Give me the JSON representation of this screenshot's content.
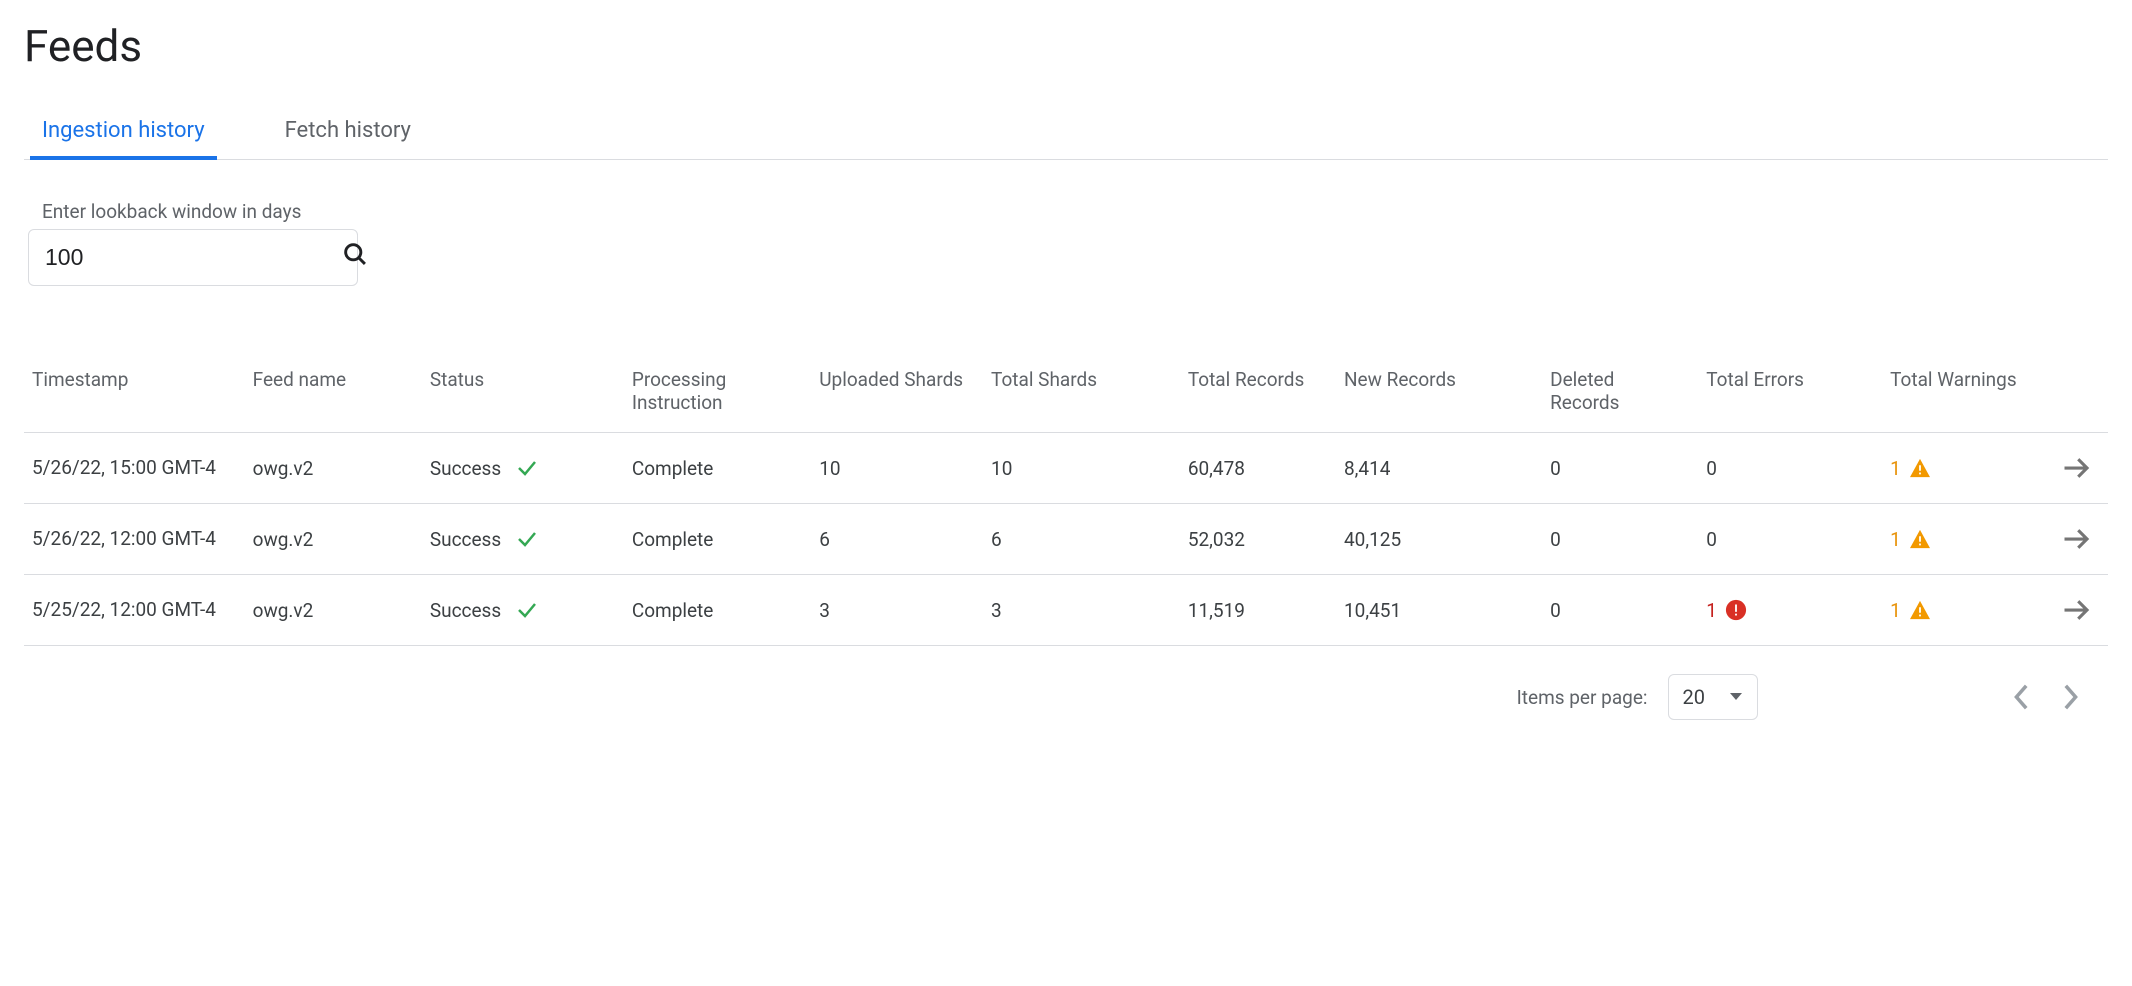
{
  "page_title": "Feeds",
  "tabs": [
    {
      "label": "Ingestion history",
      "active": true
    },
    {
      "label": "Fetch history",
      "active": false
    }
  ],
  "lookback": {
    "label": "Enter lookback window in days",
    "value": "100"
  },
  "columns": [
    "Timestamp",
    "Feed name",
    "Status",
    "Processing Instruction",
    "Uploaded Shards",
    "Total Shards",
    "Total Records",
    "New Records",
    "Deleted Records",
    "Total Errors",
    "Total Warnings"
  ],
  "rows": [
    {
      "timestamp": "5/26/22, 15:00 GMT-4",
      "feed_name": "owg.v2",
      "status": "Success",
      "processing_instruction": "Complete",
      "uploaded_shards": "10",
      "total_shards": "10",
      "total_records": "60,478",
      "new_records": "8,414",
      "deleted_records": "0",
      "total_errors": "0",
      "total_errors_has_icon": false,
      "total_warnings": "1"
    },
    {
      "timestamp": "5/26/22, 12:00 GMT-4",
      "feed_name": "owg.v2",
      "status": "Success",
      "processing_instruction": "Complete",
      "uploaded_shards": "6",
      "total_shards": "6",
      "total_records": "52,032",
      "new_records": "40,125",
      "deleted_records": "0",
      "total_errors": "0",
      "total_errors_has_icon": false,
      "total_warnings": "1"
    },
    {
      "timestamp": "5/25/22, 12:00 GMT-4",
      "feed_name": "owg.v2",
      "status": "Success",
      "processing_instruction": "Complete",
      "uploaded_shards": "3",
      "total_shards": "3",
      "total_records": "11,519",
      "new_records": "10,451",
      "deleted_records": "0",
      "total_errors": "1",
      "total_errors_has_icon": true,
      "total_warnings": "1"
    }
  ],
  "pagination": {
    "items_per_page_label": "Items per page:",
    "items_per_page_value": "20"
  }
}
